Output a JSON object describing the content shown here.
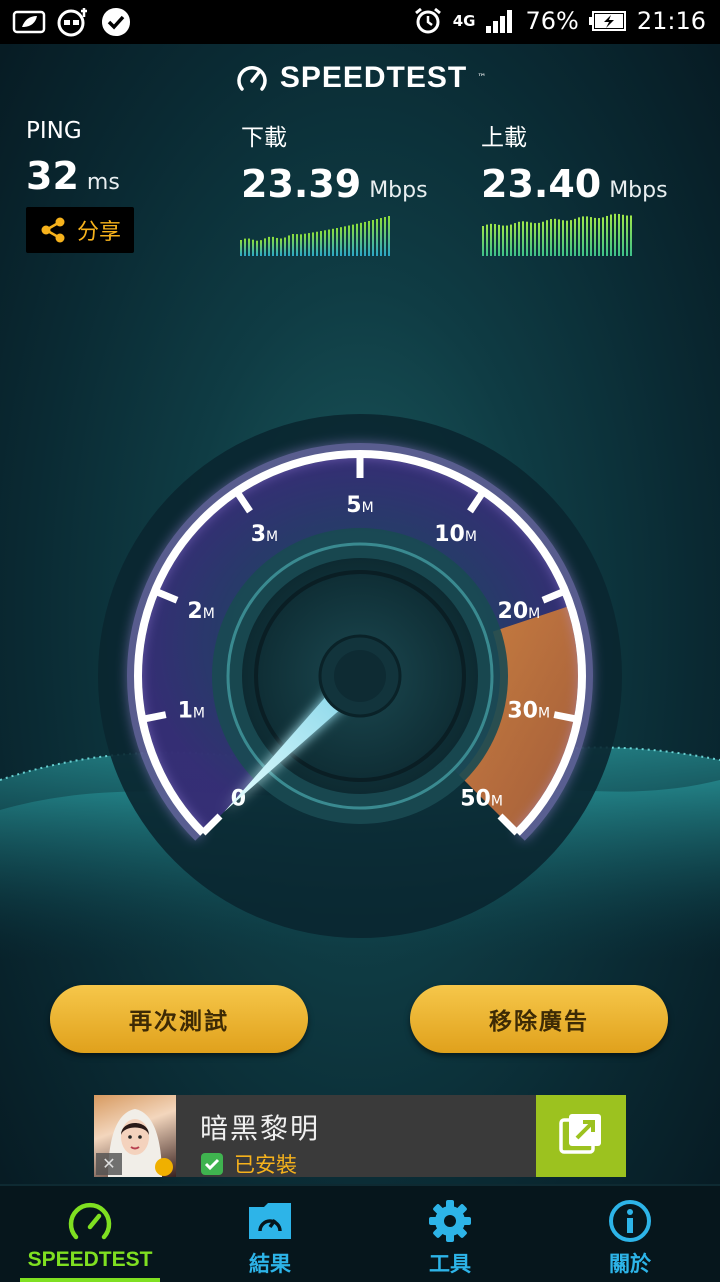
{
  "status_bar": {
    "network": "4G",
    "battery": "76%",
    "time": "21:16"
  },
  "header": {
    "brand": "SPEEDTEST",
    "tm": "™"
  },
  "ping": {
    "label": "PING",
    "value": "32",
    "unit": "ms"
  },
  "download": {
    "label": "下載",
    "value": "23.39",
    "unit": "Mbps"
  },
  "upload": {
    "label": "上載",
    "value": "23.40",
    "unit": "Mbps"
  },
  "share": {
    "label": "分享",
    "icon": "share-icon"
  },
  "gauge": {
    "needle_value_mbps": 0,
    "ticks": [
      {
        "num": "0",
        "suffix": ""
      },
      {
        "num": "1",
        "suffix": "M"
      },
      {
        "num": "2",
        "suffix": "M"
      },
      {
        "num": "3",
        "suffix": "M"
      },
      {
        "num": "5",
        "suffix": "M"
      },
      {
        "num": "10",
        "suffix": "M"
      },
      {
        "num": "20",
        "suffix": "M"
      },
      {
        "num": "30",
        "suffix": "M"
      },
      {
        "num": "50",
        "suffix": "M"
      }
    ]
  },
  "buttons": {
    "retest": "再次測試",
    "remove_ads": "移除廣告"
  },
  "ad": {
    "title": "暗黑黎明",
    "status": "已安裝",
    "close": "✕"
  },
  "nav": {
    "items": [
      {
        "label": "SPEEDTEST",
        "icon": "speedometer-icon",
        "active": true
      },
      {
        "label": "結果",
        "icon": "results-folder-icon",
        "active": false
      },
      {
        "label": "工具",
        "icon": "gear-icon",
        "active": false
      },
      {
        "label": "關於",
        "icon": "info-icon",
        "active": false
      }
    ]
  },
  "colors": {
    "accent_green": "#7fe021",
    "accent_blue": "#2db4e8",
    "accent_orange": "#f6b21c"
  }
}
